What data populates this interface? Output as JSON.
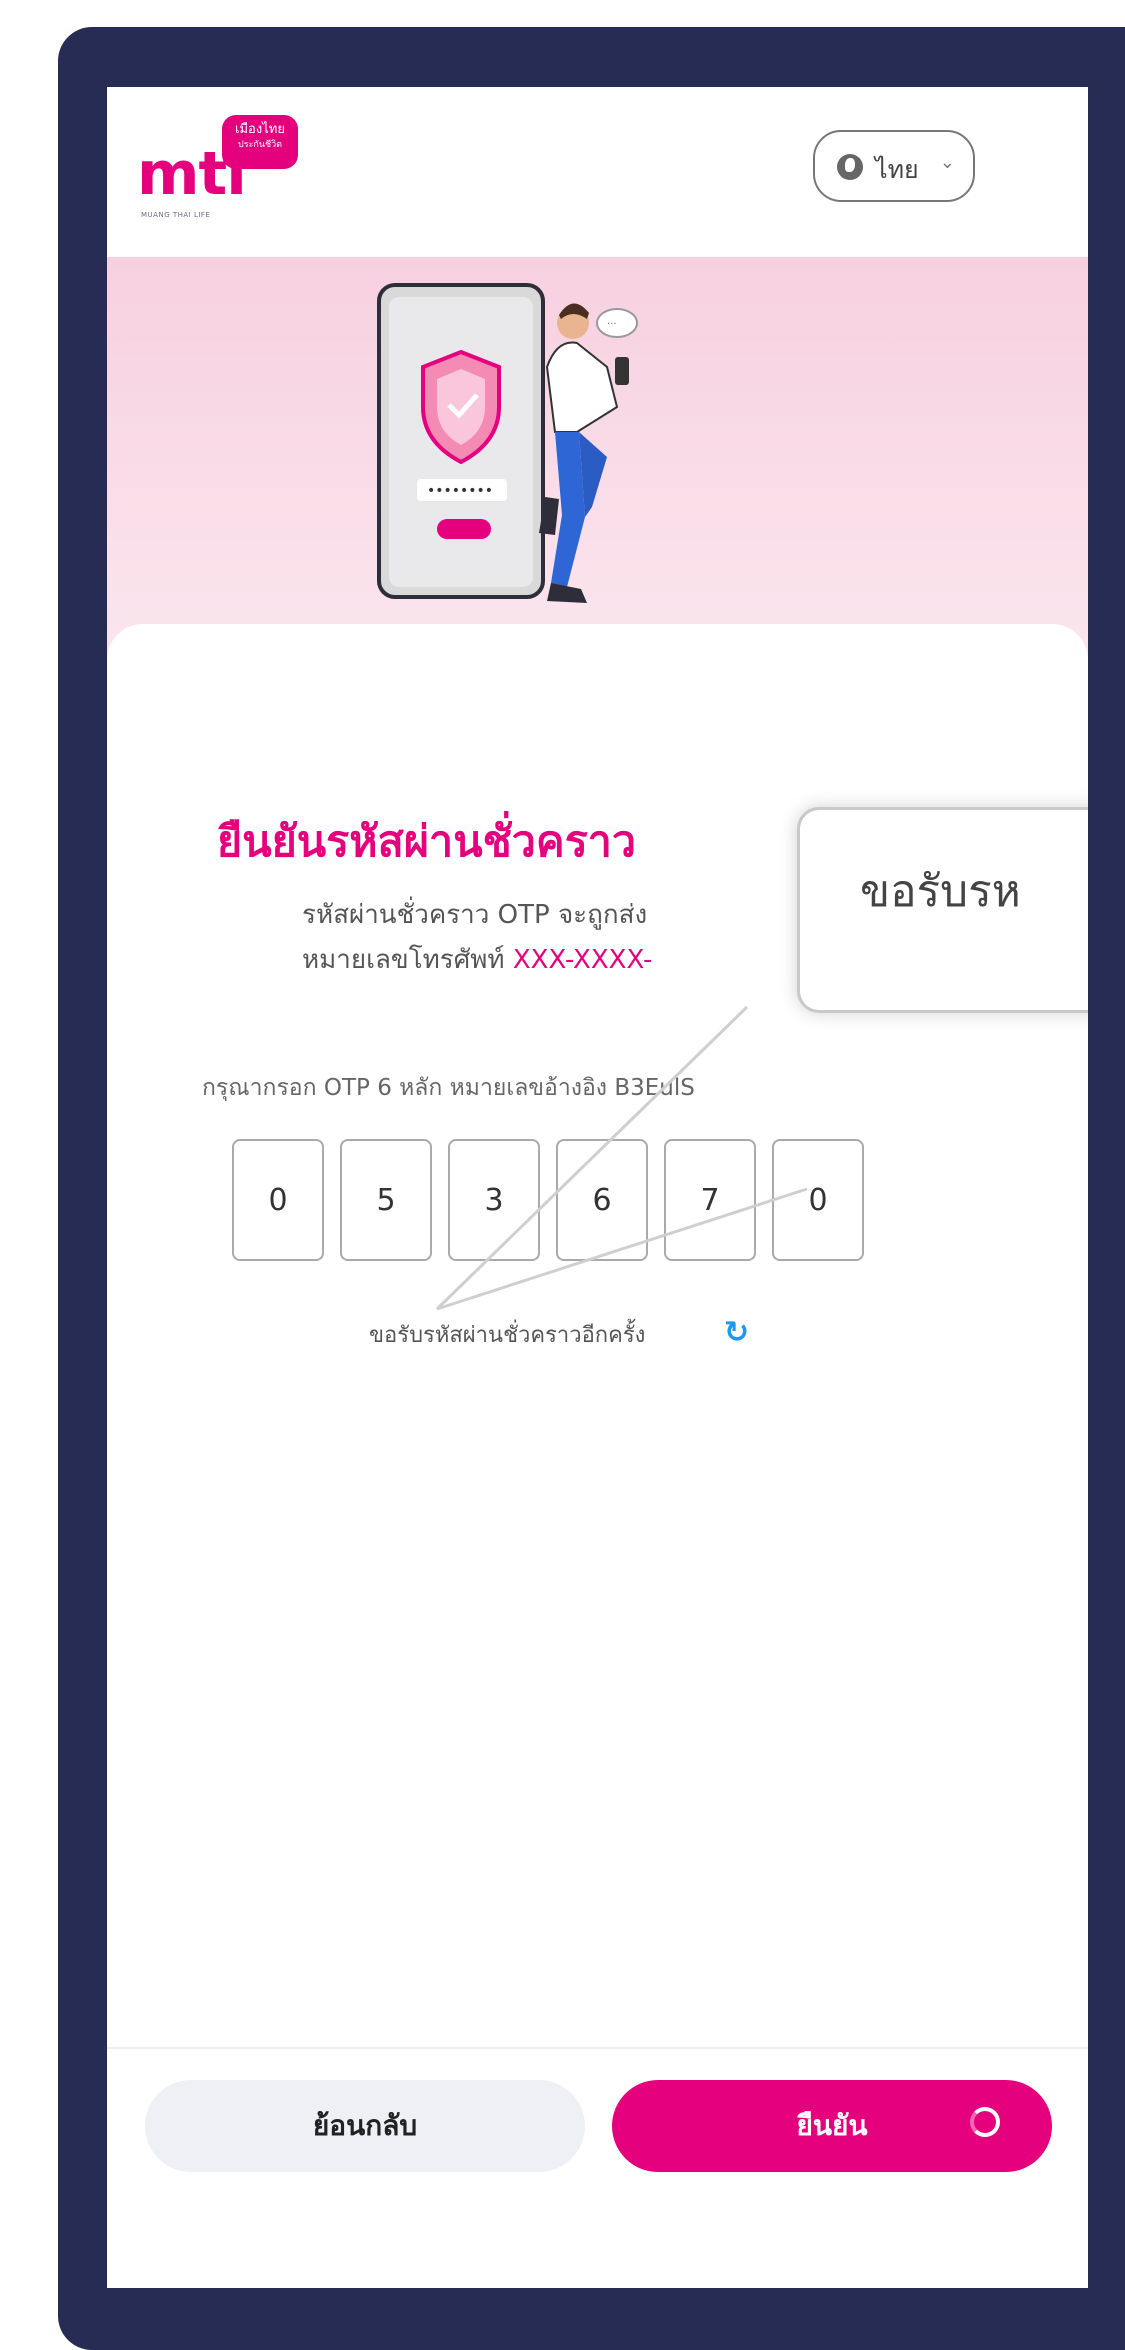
{
  "header": {
    "logo_text": "mtl",
    "logo_badge_line1": "เมืองไทย",
    "logo_badge_line2": "ประกันชีวิต",
    "logo_subtext": "MUANG THAI LIFE",
    "language_label": "ไทย"
  },
  "content": {
    "title": "ยืนยันรหัสผ่านชั่วคราว",
    "description_line1": "รหัสผ่านชั่วคราว OTP จะถูกส่ง",
    "description_line2_prefix": "หมายเลขโทรศัพท์ ",
    "phone_masked": "XXX-XXXX-",
    "prompt": "กรุณากรอก OTP 6 หลัก หมายเลขอ้างอิง B3EulS",
    "otp_digits": [
      "0",
      "5",
      "3",
      "6",
      "7",
      "0"
    ],
    "resend_label": "ขอรับรหัสผ่านชั่วคราวอีกครั้ง"
  },
  "tooltip": {
    "text": "ขอรับรห"
  },
  "footer": {
    "back_label": "ย้อนกลับ",
    "confirm_label": "ยืนยัน"
  },
  "colors": {
    "brand": "#e5007e",
    "device_frame": "#272c55",
    "refresh_icon": "#1a9af0"
  }
}
